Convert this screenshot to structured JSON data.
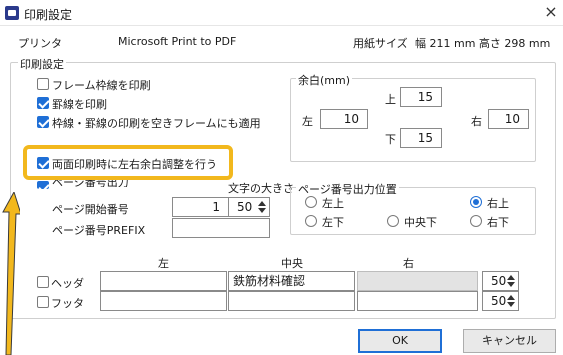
{
  "window": {
    "title": "印刷設定",
    "close_glyph": "×",
    "icon": "app-icon"
  },
  "printer": {
    "label": "プリンタ",
    "value": "Microsoft Print to PDF",
    "paper_label": "用紙サイズ",
    "paper_value": "幅  211 mm 高さ 298 mm"
  },
  "print_settings": {
    "legend": "印刷設定",
    "options": [
      {
        "label": "フレーム枠線を印刷",
        "checked": false
      },
      {
        "label": "罫線を印刷",
        "checked": true
      },
      {
        "label": "枠線・罫線の印刷を空きフレームにも適用",
        "checked": true
      },
      {
        "label": "両面印刷時に左右余白調整を行う",
        "checked": true
      }
    ],
    "page_number_output": "ページ番号出力",
    "font_size_label": "文字の大きさ",
    "start_page_label": "ページ開始番号",
    "start_page_value": "1",
    "font_size_value": "50",
    "prefix_label": "ページ番号PREFIX",
    "prefix_value": ""
  },
  "margins": {
    "legend": "余白(mm)",
    "top_label": "上",
    "top_value": "15",
    "left_label": "左",
    "left_value": "10",
    "right_label": "右",
    "right_value": "10",
    "bottom_label": "下",
    "bottom_value": "15"
  },
  "page_position": {
    "legend": "ページ番号出力位置",
    "options": [
      {
        "label": "左上",
        "checked": false
      },
      {
        "label": "右上",
        "checked": true
      },
      {
        "label": "左下",
        "checked": false
      },
      {
        "label": "中央下",
        "checked": false
      },
      {
        "label": "右下",
        "checked": false
      }
    ]
  },
  "header_footer": {
    "col_left": "左",
    "col_center": "中央",
    "col_right": "右",
    "header_label": "ヘッダ",
    "header_checked": false,
    "header_left": "",
    "header_center": "鉄筋材料確認",
    "header_right": "",
    "header_size": "50",
    "footer_label": "フッタ",
    "footer_checked": false,
    "footer_left": "",
    "footer_center": "",
    "footer_right": "",
    "footer_size": "50"
  },
  "buttons": {
    "ok": "OK",
    "cancel": "キャンセル"
  },
  "colors": {
    "accent": "#1f6fd6",
    "highlight": "#f2b81d"
  }
}
